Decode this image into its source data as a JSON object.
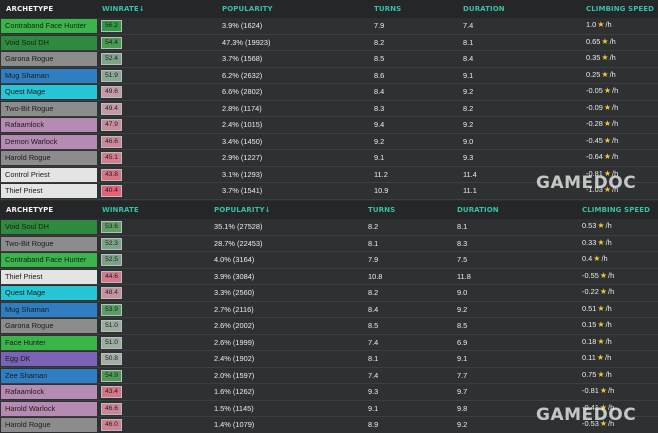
{
  "table1": {
    "headers": {
      "archetype": "ARCHETYPE",
      "winrate": "WINRATE↓",
      "popularity": "POPULARITY",
      "turns": "TURNS",
      "duration": "DURATION",
      "climbing": "CLIMBING SPEED"
    },
    "rows": [
      {
        "archetype": "Contraband Face Hunter",
        "color": "#3ab54a",
        "winrate": "56.2",
        "wrcolor": "#2f9b43",
        "popularity": "3.9% (1624)",
        "turns": "7.9",
        "duration": "7.4",
        "climb": "1.0",
        "unit": "/h"
      },
      {
        "archetype": "Void Soul DH",
        "color": "#2e8a3e",
        "winrate": "54.4",
        "wrcolor": "#4a9a50",
        "popularity": "47.3% (19923)",
        "turns": "8.2",
        "duration": "8.1",
        "climb": "0.65",
        "unit": "/h"
      },
      {
        "archetype": "Garona Rogue",
        "color": "#8c8c8c",
        "winrate": "52.4",
        "wrcolor": "#7fa38a",
        "popularity": "3.7% (1568)",
        "turns": "8.5",
        "duration": "8.4",
        "climb": "0.35",
        "unit": "/h"
      },
      {
        "archetype": "Mug Shaman",
        "color": "#2f7ec2",
        "winrate": "51.9",
        "wrcolor": "#8aa995",
        "popularity": "6.2% (2632)",
        "turns": "8.6",
        "duration": "9.1",
        "climb": "0.25",
        "unit": "/h"
      },
      {
        "archetype": "Quest Mage",
        "color": "#27c6d6",
        "winrate": "49.6",
        "wrcolor": "#c39aa6",
        "popularity": "6.6% (2802)",
        "turns": "8.4",
        "duration": "9.2",
        "climb": "-0.05",
        "unit": "/h"
      },
      {
        "archetype": "Two-Bit Rogue",
        "color": "#8c8c8c",
        "winrate": "49.4",
        "wrcolor": "#c49aa7",
        "popularity": "2.8% (1174)",
        "turns": "8.3",
        "duration": "8.2",
        "climb": "-0.09",
        "unit": "/h"
      },
      {
        "archetype": "Rafaamlock",
        "color": "#b68bb3",
        "winrate": "47.9",
        "wrcolor": "#c98e9e",
        "popularity": "2.4% (1015)",
        "turns": "9.4",
        "duration": "9.2",
        "climb": "-0.28",
        "unit": "/h"
      },
      {
        "archetype": "Demon Warlock",
        "color": "#b68bb3",
        "winrate": "46.6",
        "wrcolor": "#cd8697",
        "popularity": "3.4% (1450)",
        "turns": "9.2",
        "duration": "9.0",
        "climb": "-0.45",
        "unit": "/h"
      },
      {
        "archetype": "Harold Rogue",
        "color": "#8c8c8c",
        "winrate": "45.1",
        "wrcolor": "#d37d8e",
        "popularity": "2.9% (1227)",
        "turns": "9.1",
        "duration": "9.3",
        "climb": "-0.64",
        "unit": "/h"
      },
      {
        "archetype": "Control Priest",
        "color": "#e4e4e4",
        "winrate": "43.8",
        "wrcolor": "#d97386",
        "popularity": "3.1% (1293)",
        "turns": "11.2",
        "duration": "11.4",
        "climb": "-0.81",
        "unit": "/h"
      },
      {
        "archetype": "Thief Priest",
        "color": "#e4e4e4",
        "winrate": "40.4",
        "wrcolor": "#e2627a",
        "popularity": "3.7% (1541)",
        "turns": "10.9",
        "duration": "11.1",
        "climb": "-1.03",
        "unit": "/h"
      }
    ]
  },
  "table2": {
    "headers": {
      "archetype": "ARCHETYPE",
      "winrate": "WINRATE",
      "popularity": "POPULARITY↓",
      "turns": "TURNS",
      "duration": "DURATION",
      "climbing": "CLIMBING SPEED"
    },
    "rows": [
      {
        "archetype": "Void Soul DH",
        "color": "#2e8a3e",
        "winrate": "53.6",
        "wrcolor": "#5fa067",
        "popularity": "35.1% (27528)",
        "turns": "8.2",
        "duration": "8.1",
        "climb": "0.53",
        "unit": "/h"
      },
      {
        "archetype": "Two-Bit Rogue",
        "color": "#8c8c8c",
        "winrate": "52.3",
        "wrcolor": "#7ea488",
        "popularity": "28.7% (22453)",
        "turns": "8.1",
        "duration": "8.3",
        "climb": "0.33",
        "unit": "/h"
      },
      {
        "archetype": "Contraband Face Hunter",
        "color": "#3ab54a",
        "winrate": "52.5",
        "wrcolor": "#7aa385",
        "popularity": "4.0% (3164)",
        "turns": "7.9",
        "duration": "7.5",
        "climb": "0.4",
        "unit": "/h"
      },
      {
        "archetype": "Thief Priest",
        "color": "#e4e4e4",
        "winrate": "44.6",
        "wrcolor": "#d27a8c",
        "popularity": "3.9% (3084)",
        "turns": "10.8",
        "duration": "11.8",
        "climb": "-0.55",
        "unit": "/h"
      },
      {
        "archetype": "Quest Mage",
        "color": "#27c6d6",
        "winrate": "48.4",
        "wrcolor": "#c7929f",
        "popularity": "3.3% (2560)",
        "turns": "8.2",
        "duration": "9.0",
        "climb": "-0.22",
        "unit": "/h"
      },
      {
        "archetype": "Mug Shaman",
        "color": "#2f7ec2",
        "winrate": "53.9",
        "wrcolor": "#5b9e64",
        "popularity": "2.7% (2116)",
        "turns": "8.4",
        "duration": "9.2",
        "climb": "0.51",
        "unit": "/h"
      },
      {
        "archetype": "Garona Rogue",
        "color": "#8c8c8c",
        "winrate": "51.0",
        "wrcolor": "#9aad9e",
        "popularity": "2.6% (2002)",
        "turns": "8.5",
        "duration": "8.5",
        "climb": "0.15",
        "unit": "/h"
      },
      {
        "archetype": "Face Hunter",
        "color": "#3ab54a",
        "winrate": "51.0",
        "wrcolor": "#9aad9e",
        "popularity": "2.6% (1999)",
        "turns": "7.4",
        "duration": "6.9",
        "climb": "0.18",
        "unit": "/h"
      },
      {
        "archetype": "Egg DK",
        "color": "#7a63b6",
        "winrate": "50.8",
        "wrcolor": "#a3ada4",
        "popularity": "2.4% (1902)",
        "turns": "8.1",
        "duration": "9.1",
        "climb": "0.11",
        "unit": "/h"
      },
      {
        "archetype": "Zee Shaman",
        "color": "#2f7ec2",
        "winrate": "54.9",
        "wrcolor": "#4e9b57",
        "popularity": "2.0% (1597)",
        "turns": "7.4",
        "duration": "7.7",
        "climb": "0.75",
        "unit": "/h"
      },
      {
        "archetype": "Rafaamlock",
        "color": "#b68bb3",
        "winrate": "43.4",
        "wrcolor": "#d87488",
        "popularity": "1.6% (1262)",
        "turns": "9.3",
        "duration": "9.7",
        "climb": "-0.81",
        "unit": "/h"
      },
      {
        "archetype": "Harold Warlock",
        "color": "#b68bb3",
        "winrate": "46.6",
        "wrcolor": "#cd8697",
        "popularity": "1.5% (1145)",
        "turns": "9.1",
        "duration": "9.8",
        "climb": "-0.41",
        "unit": "/h"
      },
      {
        "archetype": "Harold Rogue",
        "color": "#8c8c8c",
        "winrate": "46.0",
        "wrcolor": "#cf8293",
        "popularity": "1.4% (1079)",
        "turns": "8.9",
        "duration": "9.2",
        "climb": "-0.53",
        "unit": "/h"
      }
    ]
  },
  "watermark": "GAMEDOC"
}
